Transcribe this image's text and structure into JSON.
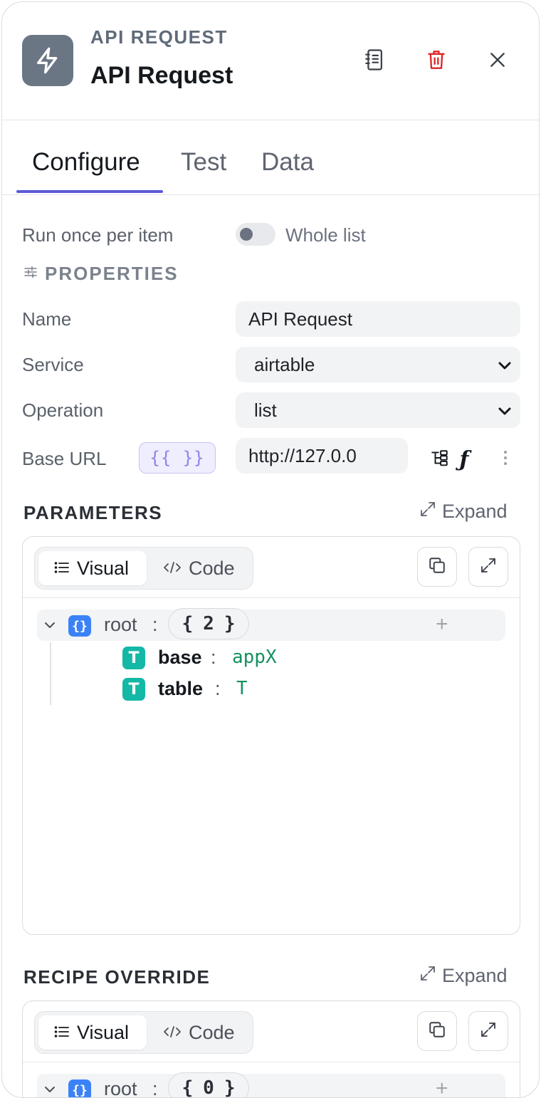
{
  "header": {
    "kicker": "API REQUEST",
    "title": "API Request"
  },
  "tabs": [
    {
      "label": "Configure",
      "active": true
    },
    {
      "label": "Test",
      "active": false
    },
    {
      "label": "Data",
      "active": false
    }
  ],
  "run_mode": {
    "left_label": "Run once per item",
    "right_label": "Whole list",
    "whole_list_enabled": false
  },
  "properties": {
    "section_title": "PROPERTIES",
    "name_label": "Name",
    "name_value": "API Request",
    "service_label": "Service",
    "service_value": "airtable",
    "operation_label": "Operation",
    "operation_value": "list",
    "base_url_label": "Base URL",
    "template_chip": "{{ }}",
    "base_url_value": "http://127.0.0"
  },
  "parameters": {
    "title": "PARAMETERS",
    "expand_label": "Expand",
    "visual_label": "Visual",
    "code_label": "Code",
    "root_key": "root",
    "root_count": "2",
    "items": [
      {
        "key": "base",
        "value": "appX"
      },
      {
        "key": "table",
        "value": "T"
      }
    ]
  },
  "recipe_override": {
    "title": "RECIPE OVERRIDE",
    "expand_label": "Expand",
    "visual_label": "Visual",
    "code_label": "Code",
    "root_key": "root",
    "root_count": "0"
  },
  "colors": {
    "accent": "#5b5bd6",
    "node_icon_bg": "#6b7685",
    "delete_red": "#dc2626",
    "object_badge": "#3b82f6",
    "string_badge": "#14b8a6",
    "string_value": "#15915f"
  },
  "icons": {
    "node": "lightning-icon",
    "docs": "notebook-icon",
    "delete": "trash-icon",
    "close": "close-icon",
    "properties": "sliders-icon",
    "expand": "expand-arrows-icon",
    "visual": "list-icon",
    "code": "code-icon",
    "copy": "copy-icon",
    "fullscreen": "fullscreen-icon"
  }
}
